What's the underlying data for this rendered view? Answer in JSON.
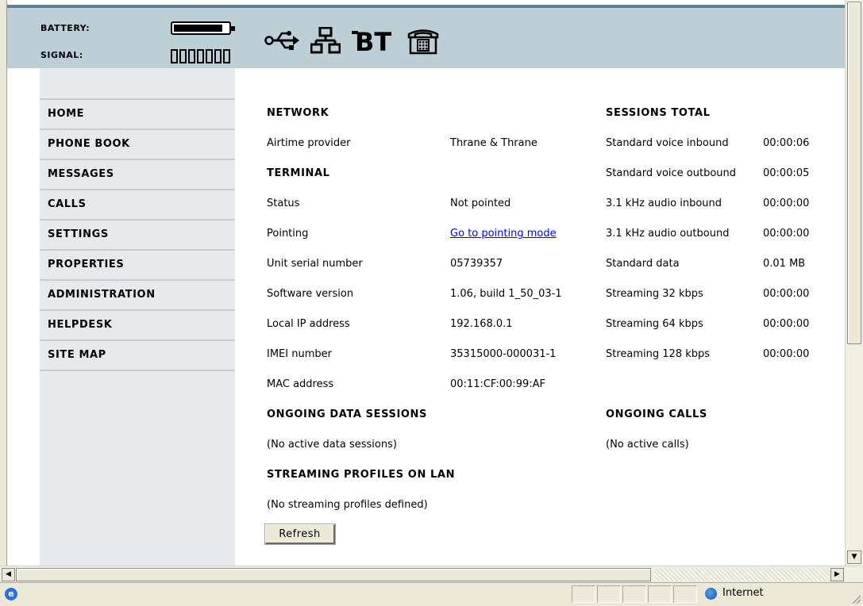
{
  "header": {
    "battery_label": "BATTERY:",
    "signal_label": "SIGNAL:",
    "battery_level": 0.9,
    "signal_bars": 7,
    "icons": [
      "usb-icon",
      "lan-icon",
      "bluetooth-icon",
      "phone-icon"
    ],
    "bt_text": "BT",
    "background_color": "#bcced6",
    "top_border_color": "#5d7f8f"
  },
  "sidebar": {
    "background_color": "#e6eaec",
    "items": [
      {
        "label": "HOME"
      },
      {
        "label": "PHONE BOOK"
      },
      {
        "label": "MESSAGES"
      },
      {
        "label": "CALLS"
      },
      {
        "label": "SETTINGS"
      },
      {
        "label": "PROPERTIES"
      },
      {
        "label": "ADMINISTRATION"
      },
      {
        "label": "HELPDESK"
      },
      {
        "label": "SITE MAP"
      }
    ]
  },
  "network": {
    "heading": "NETWORK",
    "airtime_label": "Airtime provider",
    "airtime_value": "Thrane & Thrane"
  },
  "terminal": {
    "heading": "TERMINAL",
    "rows": [
      {
        "label": "Status",
        "value": "Not pointed"
      },
      {
        "label": "Pointing",
        "value": "Go to pointing mode"
      },
      {
        "label": "Unit serial number",
        "value": "05739357"
      },
      {
        "label": "Software version",
        "value": "1.06, build 1_50_03-1"
      },
      {
        "label": "Local IP address",
        "value": "192.168.0.1"
      },
      {
        "label": "IMEI number",
        "value": "35315000-000031-1"
      },
      {
        "label": "MAC address",
        "value": "00:11:CF:00:99:AF"
      }
    ]
  },
  "sessions_total": {
    "heading": "SESSIONS TOTAL",
    "rows": [
      {
        "label": "Standard voice inbound",
        "value": "00:00:06"
      },
      {
        "label": "Standard voice outbound",
        "value": "00:00:05"
      },
      {
        "label": "3.1 kHz audio inbound",
        "value": "00:00:00"
      },
      {
        "label": "3.1 kHz audio outbound",
        "value": "00:00:00"
      },
      {
        "label": "Standard data",
        "value": "0.01 MB"
      },
      {
        "label": "Streaming 32 kbps",
        "value": "00:00:00"
      },
      {
        "label": "Streaming 64 kbps",
        "value": "00:00:00"
      },
      {
        "label": "Streaming 128 kbps",
        "value": "00:00:00"
      }
    ]
  },
  "ongoing_data": {
    "heading": "ONGOING DATA SESSIONS",
    "text": "(No active data sessions)"
  },
  "ongoing_calls": {
    "heading": "ONGOING CALLS",
    "text": "(No active calls)"
  },
  "streaming_profiles": {
    "heading": "STREAMING PROFILES ON LAN",
    "text": "(No streaming profiles defined)"
  },
  "refresh_button": {
    "label": "Refresh"
  },
  "statusbar": {
    "zone_text": "Internet"
  },
  "colors": {
    "link": "#0000ee"
  }
}
